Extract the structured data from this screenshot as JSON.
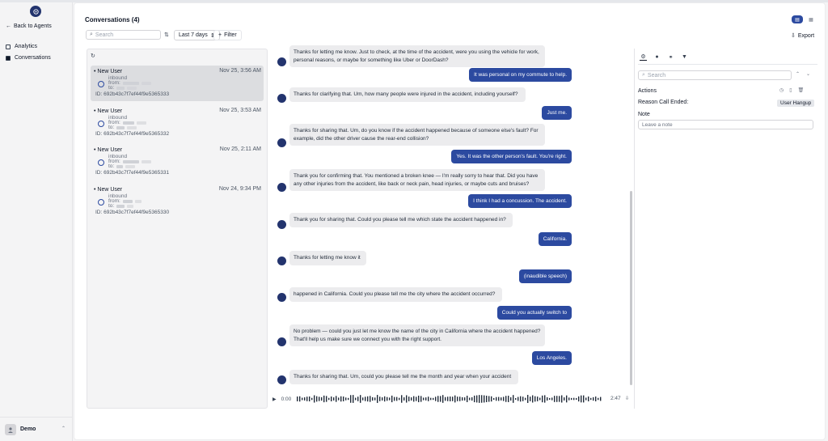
{
  "sidebar": {
    "back_label": "Back to Agents",
    "nav": [
      {
        "label": "Analytics",
        "icon": "chart-icon"
      },
      {
        "label": "Conversations",
        "icon": "inbox-icon"
      }
    ],
    "user": {
      "name": "Demo"
    }
  },
  "header": {
    "title": "Conversations (4)",
    "export_label": "Export"
  },
  "toolbar": {
    "search_placeholder": "Search",
    "date_range": "Last 7 days",
    "filter_label": "Filter"
  },
  "conversations": [
    {
      "name": "New User",
      "time": "Nov 25, 3:56 AM",
      "direction": "inbound",
      "from_label": "from:",
      "to_label": "to:",
      "id": "ID: 692b43c7f7ef44f9e5365333",
      "selected": true
    },
    {
      "name": "New User",
      "time": "Nov 25, 3:53 AM",
      "direction": "inbound",
      "from_label": "from:",
      "to_label": "to:",
      "id": "ID: 692b43c7f7ef44f9e5365332",
      "selected": false
    },
    {
      "name": "New User",
      "time": "Nov 25, 2:11 AM",
      "direction": "inbound",
      "from_label": "from:",
      "to_label": "to:",
      "id": "ID: 692b43c7f7ef44f9e5365331",
      "selected": false
    },
    {
      "name": "New User",
      "time": "Nov 24, 9:34 PM",
      "direction": "inbound",
      "from_label": "from:",
      "to_label": "to:",
      "id": "ID: 692b43c7f7ef44f9e5365330",
      "selected": false
    }
  ],
  "transcript": [
    {
      "role": "agent",
      "text": "Thanks for letting me know. Just to check, at the time of the accident, were you using the vehicle for work, personal reasons, or maybe for something like Uber or DoorDash?"
    },
    {
      "role": "user",
      "text": "It was personal on my commute to help."
    },
    {
      "role": "agent",
      "text": "Thanks for clarifying that. Um, how many people were injured in the accident, including yourself?"
    },
    {
      "role": "user",
      "text": "Just me."
    },
    {
      "role": "agent",
      "text": "Thanks for sharing that. Um, do you know if the accident happened because of someone else's fault? For example, did the other driver cause the rear-end collision?"
    },
    {
      "role": "user",
      "text": "Yes. It was the other person's fault. You're right."
    },
    {
      "role": "agent",
      "text": "Thank you for confirming that. You mentioned a broken knee — I'm really sorry to hear that. Did you have any other injuries from the accident, like back or neck pain, head injuries, or maybe cuts and bruises?"
    },
    {
      "role": "user",
      "text": "I think I had a concussion. The accident."
    },
    {
      "role": "agent",
      "text": "Thank you for sharing that. Could you please tell me which state the accident happened in?"
    },
    {
      "role": "user",
      "text": "California."
    },
    {
      "role": "agent",
      "text": "Thanks for letting me know it"
    },
    {
      "role": "user",
      "text": "(inaudible speech)"
    },
    {
      "role": "agent",
      "text": "happened in California. Could you please tell me the city where the accident occurred?"
    },
    {
      "role": "user",
      "text": "Could you actually switch to"
    },
    {
      "role": "agent",
      "text": "No problem — could you just let me know the name of the city in California where the accident happened? That'll help us make sure we connect you with the right support."
    },
    {
      "role": "user",
      "text": "Los Angeles."
    },
    {
      "role": "agent",
      "text": "Thanks for sharing that. Um, could you please tell me the month and year when your accident"
    }
  ],
  "audio": {
    "current": "0:00",
    "duration": "2:47",
    "progress": 0
  },
  "details": {
    "search_placeholder": "Search",
    "actions_label": "Actions",
    "reason_label": "Reason Call Ended:",
    "reason_value": "User Hangup",
    "note_label": "Note",
    "note_placeholder": "Leave a note"
  },
  "colors": {
    "accent": "#2c4aa0",
    "brand": "#23346e"
  }
}
